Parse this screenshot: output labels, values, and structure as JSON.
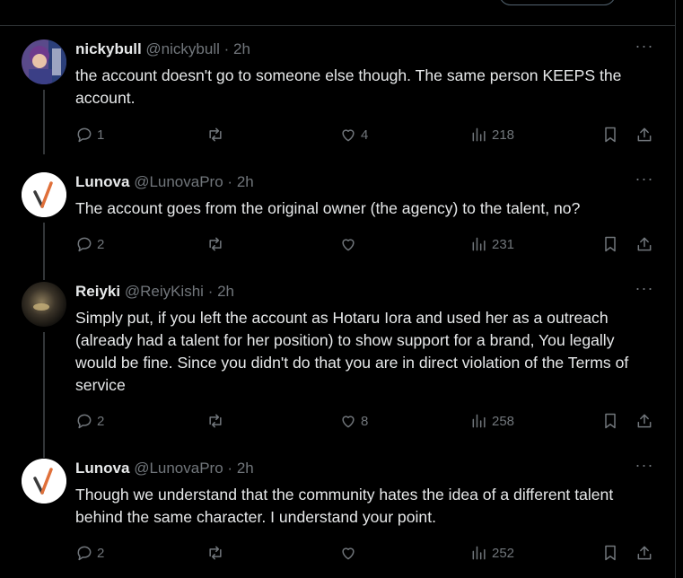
{
  "tweets": [
    {
      "name": "nickybull",
      "handle": "@nickybull",
      "dot": "·",
      "time": "2h",
      "text": "the account doesn't go to someone else though. The same person KEEPS the account.",
      "replies": "1",
      "retweets": "",
      "likes": "4",
      "views": "218"
    },
    {
      "name": "Lunova",
      "handle": "@LunovaPro",
      "dot": "·",
      "time": "2h",
      "text": "The account goes from the original owner (the agency) to the talent, no?",
      "replies": "2",
      "retweets": "",
      "likes": "",
      "views": "231"
    },
    {
      "name": "Reiyki",
      "handle": "@ReiyKishi",
      "dot": "·",
      "time": "2h",
      "text": "Simply put, if you left the account as Hotaru Iora and used her as a outreach (already had a talent for her position) to show support for a brand, You legally would be fine. Since you didn't do that you are in direct violation of the Terms of service",
      "replies": "2",
      "retweets": "",
      "likes": "8",
      "views": "258"
    },
    {
      "name": "Lunova",
      "handle": "@LunovaPro",
      "dot": "·",
      "time": "2h",
      "text": "Though we understand that the community hates the idea of a different talent behind the same character. I understand your point.",
      "replies": "2",
      "retweets": "",
      "likes": "",
      "views": "252"
    }
  ],
  "icons": {
    "more": "more-icon",
    "reply": "reply-icon",
    "retweet": "retweet-icon",
    "like": "heart-icon",
    "views": "views-icon",
    "bookmark": "bookmark-icon",
    "share": "share-icon"
  },
  "colors": {
    "background": "#000000",
    "text": "#e7e9ea",
    "muted": "#71767b",
    "border": "#2f3336",
    "lunova_accent": "#e0703a"
  }
}
